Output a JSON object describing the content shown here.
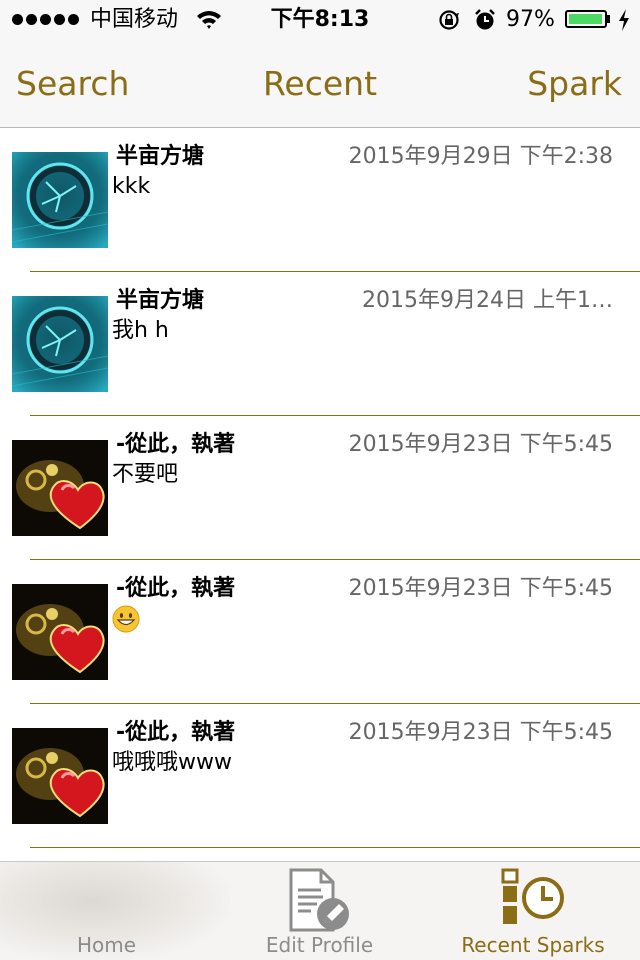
{
  "status_bar": {
    "carrier": "中国移动",
    "time": "下午8:13",
    "battery_percent": "97%",
    "battery_level": 0.97,
    "signal_bars": 5
  },
  "nav": {
    "left_label": "Search",
    "title": "Recent",
    "right_label": "Spark"
  },
  "colors": {
    "accent": "#8a6d14",
    "date": "#666666",
    "battery": "#4cd964"
  },
  "messages": [
    {
      "sender": "半亩方塘",
      "date": "2015年9月29日 下午2:38",
      "text": "kkk",
      "avatar": "teal-clock-avatar"
    },
    {
      "sender": "半亩方塘",
      "date": "2015年9月24日 上午1…",
      "text": "我h h",
      "avatar": "teal-clock-avatar"
    },
    {
      "sender": "-從此，執著",
      "date": "2015年9月23日 下午5:45",
      "text": "不要吧",
      "avatar": "red-heart-avatar"
    },
    {
      "sender": "-從此，執著",
      "date": "2015年9月23日 下午5:45",
      "text": "",
      "emoji": "grinning-face-emoji",
      "avatar": "red-heart-avatar"
    },
    {
      "sender": "-從此，執著",
      "date": "2015年9月23日 下午5:45",
      "text": "哦哦哦www",
      "avatar": "red-heart-avatar"
    }
  ],
  "tabs": [
    {
      "label": "Home",
      "icon": "home-icon",
      "active": false
    },
    {
      "label": "Edit Profile",
      "icon": "edit-profile-icon",
      "active": false
    },
    {
      "label": "Recent Sparks",
      "icon": "recent-sparks-icon",
      "active": true
    }
  ]
}
